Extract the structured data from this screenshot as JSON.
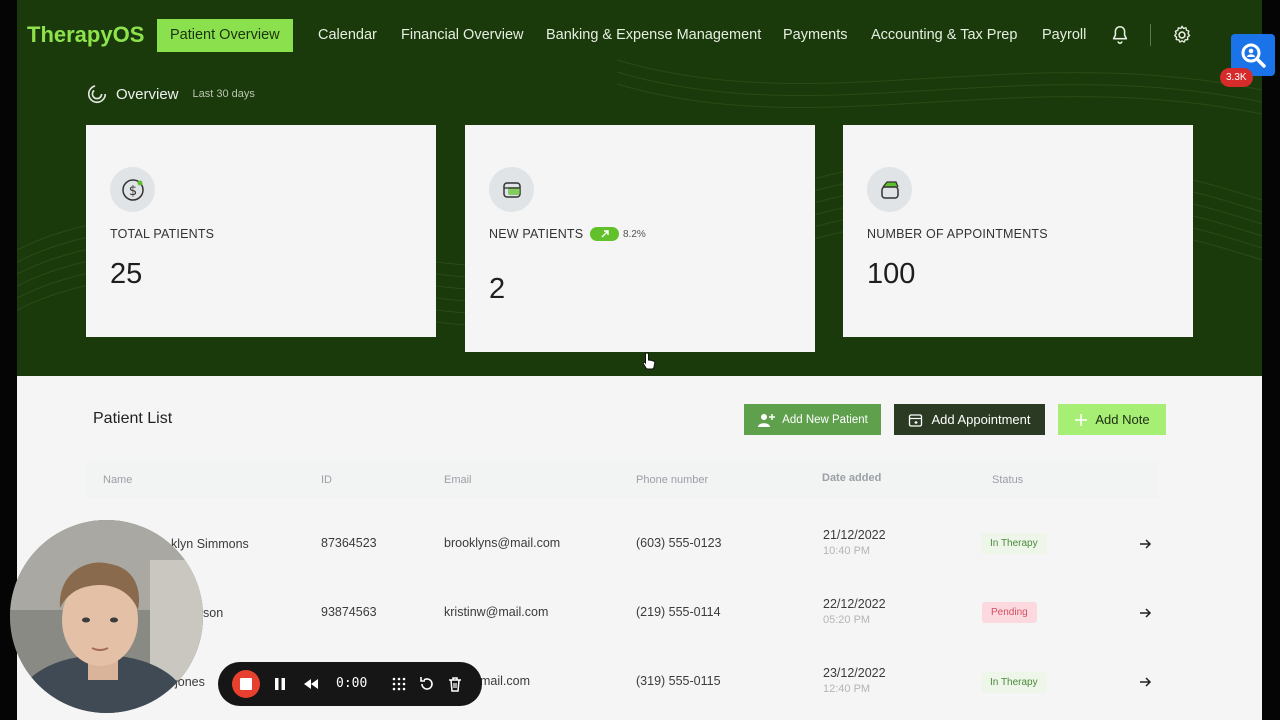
{
  "app": {
    "brand": "TherapyOS"
  },
  "nav": {
    "items": [
      {
        "label": "Patient Overview",
        "active": true
      },
      {
        "label": "Calendar"
      },
      {
        "label": "Financial Overview"
      },
      {
        "label": "Banking & Expense Management"
      },
      {
        "label": "Payments"
      },
      {
        "label": "Accounting & Tax Prep"
      },
      {
        "label": "Payroll"
      }
    ],
    "icons": [
      "bell-icon",
      "gear-icon"
    ]
  },
  "overview": {
    "title": "Overview",
    "period": "Last 30 days"
  },
  "cards": [
    {
      "label": "TOTAL PATIENTS",
      "value": "25",
      "icon": "dollar-circle-icon"
    },
    {
      "label": "NEW PATIENTS",
      "value": "2",
      "icon": "card-icon",
      "change": "8.2%"
    },
    {
      "label": "NUMBER OF APPOINTMENTS",
      "value": "100",
      "icon": "wallet-icon"
    }
  ],
  "patient_list": {
    "title": "Patient List",
    "buttons": {
      "add_patient": "Add New Patient",
      "add_appointment": "Add Appointment",
      "add_note": "Add Note"
    },
    "columns": [
      "Name",
      "ID",
      "Email",
      "Phone number",
      "Date added",
      "Status"
    ],
    "rows": [
      {
        "name": "klyn Simmons",
        "id": "87364523",
        "email": "brooklyns@mail.com",
        "phone": "(603) 555-0123",
        "date": "21/12/2022",
        "time": "10:40 PM",
        "status": "In Therapy"
      },
      {
        "name": "son",
        "id": "93874563",
        "email": "kristinw@mail.com",
        "phone": "(219) 555-0114",
        "date": "22/12/2022",
        "time": "05:20 PM",
        "status": "Pending"
      },
      {
        "name": "jones",
        "id": "",
        "email": "mail.com",
        "phone": "(319) 555-0115",
        "date": "23/12/2022",
        "time": "12:40 PM",
        "status": "In Therapy"
      }
    ]
  },
  "recorder": {
    "time": "0:00"
  },
  "extension": {
    "badge": "3.3K"
  },
  "colors": {
    "hero": "#1b3a0c",
    "brand": "#8ee34c",
    "accent": "#8be04e",
    "pending": "#d45065"
  }
}
